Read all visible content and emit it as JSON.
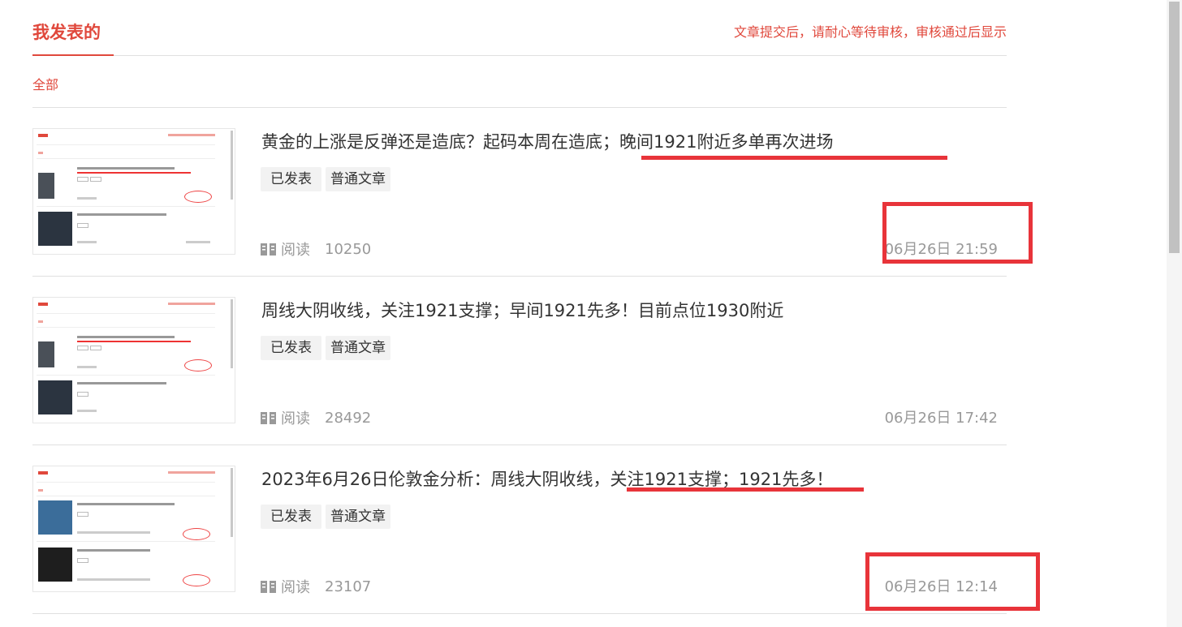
{
  "header": {
    "title": "我发表的",
    "notice": "文章提交后，请耐心等待审核，审核通过后显示"
  },
  "filter": {
    "all": "全部"
  },
  "articles": [
    {
      "title": "黄金的上涨是反弹还是造底？起码本周在造底；晚间1921附近多单再次进场",
      "status": "已发表",
      "type": "普通文章",
      "reads_label": "阅读",
      "reads": "10250",
      "time": "06月26日 21:59"
    },
    {
      "title": "周线大阴收线，关注1921支撑；早间1921先多！目前点位1930附近",
      "status": "已发表",
      "type": "普通文章",
      "reads_label": "阅读",
      "reads": "28492",
      "time": "06月26日 17:42"
    },
    {
      "title": "2023年6月26日伦敦金分析：周线大阴收线，关注1921支撑；1921先多！",
      "status": "已发表",
      "type": "普通文章",
      "reads_label": "阅读",
      "reads": "23107",
      "time": "06月26日 12:14"
    }
  ],
  "icons": {
    "reads": "book-icon"
  },
  "colors": {
    "accent": "#e0483c",
    "annotation": "#e8343a",
    "muted": "#999999"
  }
}
